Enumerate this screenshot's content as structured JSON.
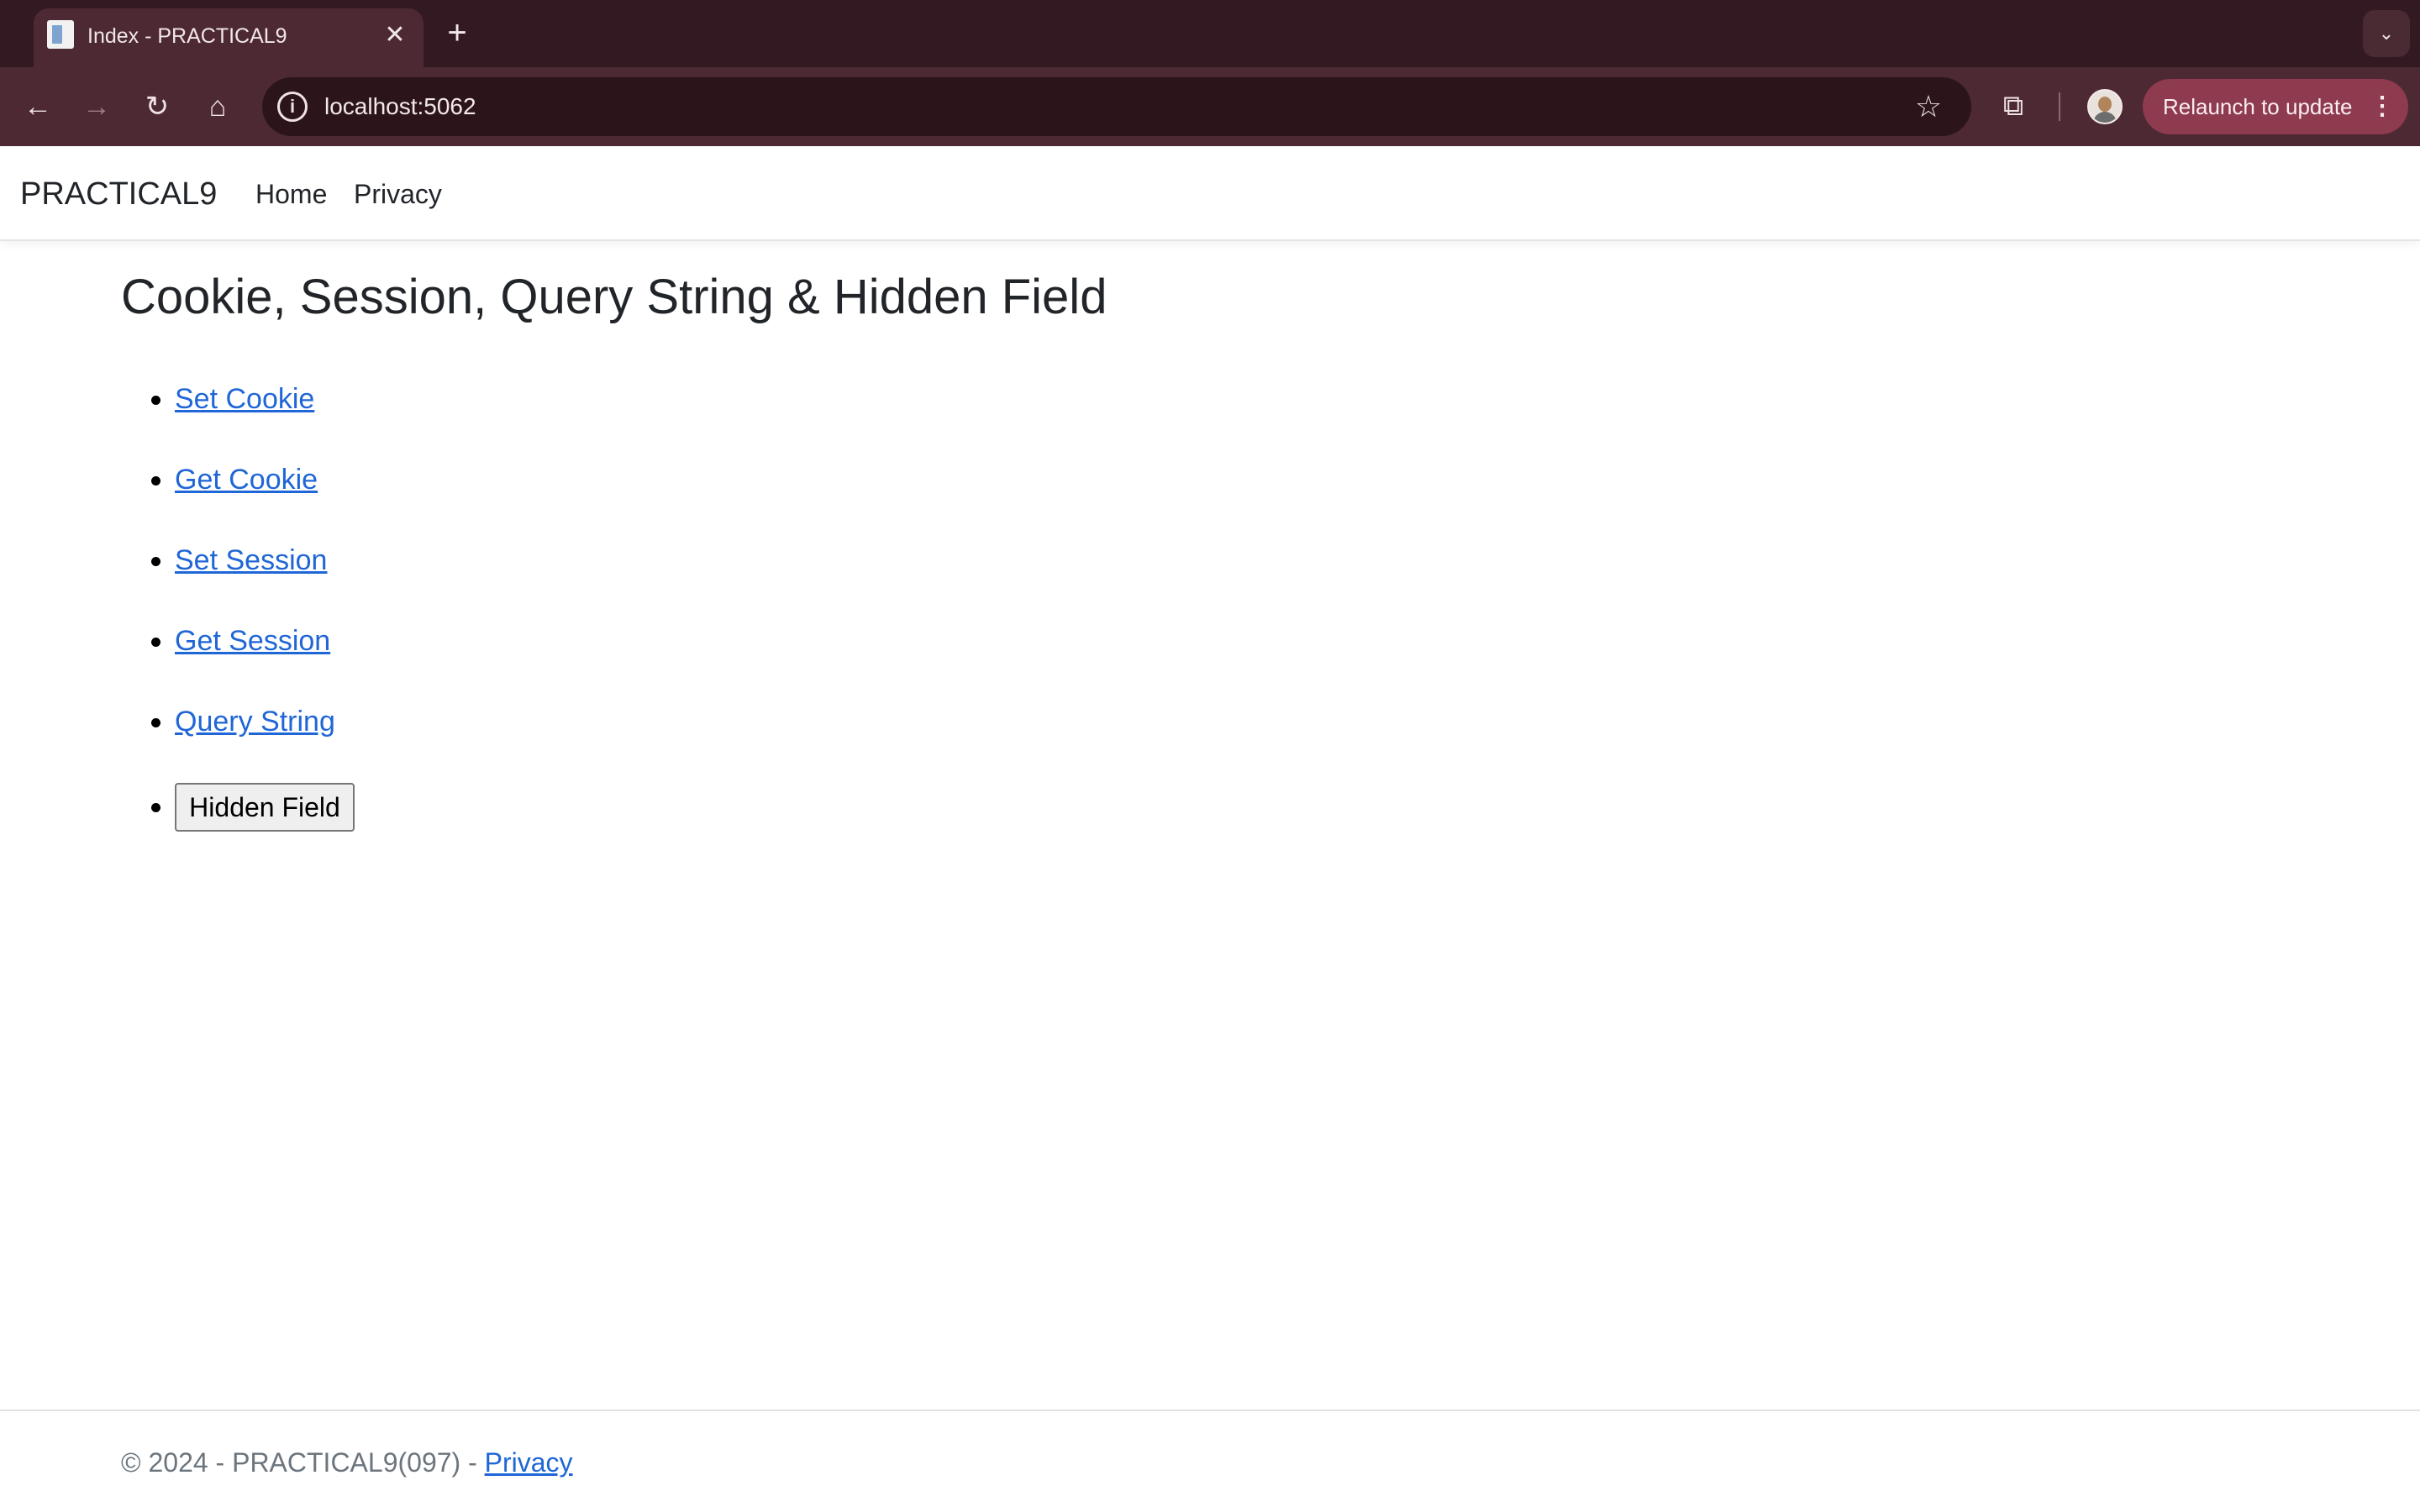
{
  "browser": {
    "tab": {
      "title": "Index - PRACTICAL9",
      "close_glyph": "✕",
      "favicon": "page-icon"
    },
    "new_tab_glyph": "+",
    "tab_list_glyph": "⌄",
    "nav": {
      "back_glyph": "←",
      "forward_glyph": "→",
      "reload_glyph": "↻",
      "home_glyph": "⌂"
    },
    "omnibox": {
      "url": "localhost:5062",
      "site_info_glyph": "i",
      "star_glyph": "☆"
    },
    "extensions_glyph": "⧉",
    "relaunch": {
      "label": "Relaunch to update",
      "menu_glyph": "⋮"
    },
    "colors": {
      "tabstrip": "#331a22",
      "toolbar": "#4d2a33",
      "relaunch": "#8e3a4f"
    }
  },
  "navbar": {
    "brand": "PRACTICAL9",
    "links": [
      {
        "label": "Home"
      },
      {
        "label": "Privacy"
      }
    ]
  },
  "main": {
    "heading": "Cookie, Session, Query String & Hidden Field",
    "links": [
      {
        "label": "Set Cookie"
      },
      {
        "label": "Get Cookie"
      },
      {
        "label": "Set Session"
      },
      {
        "label": "Get Session"
      },
      {
        "label": "Query String"
      }
    ],
    "hidden_field_button": "Hidden Field"
  },
  "footer": {
    "text": "© 2024 - PRACTICAL9(097) - ",
    "link": "Privacy"
  },
  "colors": {
    "link": "#1f66d6",
    "text": "#212529",
    "muted": "#6c757d"
  }
}
